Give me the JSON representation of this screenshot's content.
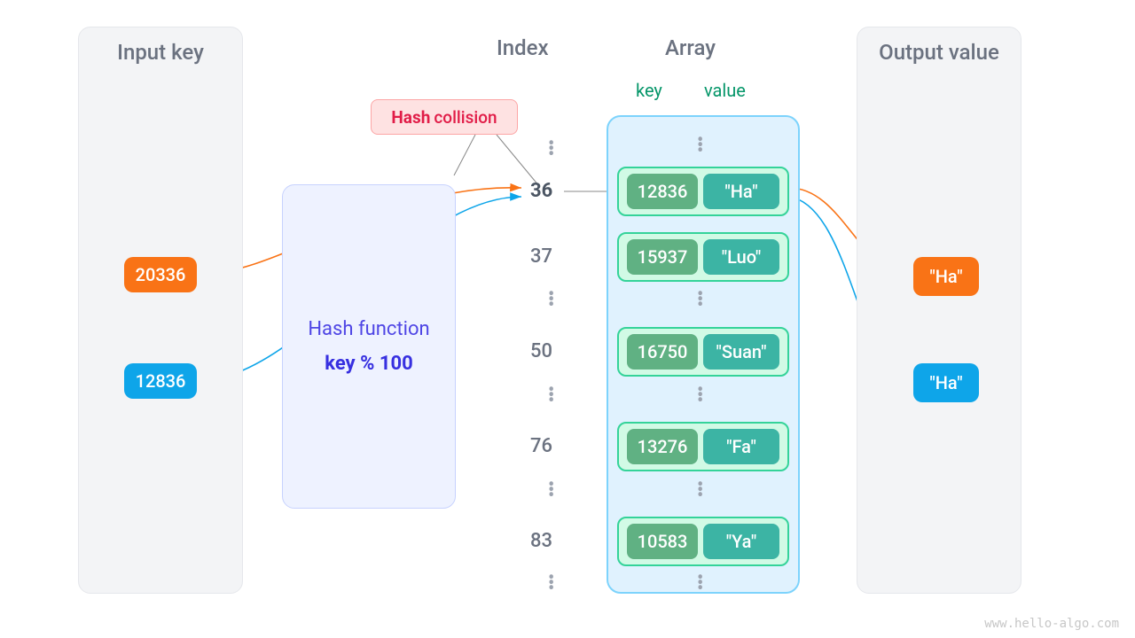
{
  "panels": {
    "input_title": "Input key",
    "output_title": "Output value"
  },
  "columns": {
    "index_title": "Index",
    "array_title": "Array",
    "kv_key_label": "key",
    "kv_val_label": "value"
  },
  "hashfn": {
    "title": "Hash function",
    "expr": "key % 100"
  },
  "collision": {
    "bold": "Hash",
    "rest": "collision"
  },
  "inputs": {
    "k1": "20336",
    "k2": "12836"
  },
  "outputs": {
    "v1": "\"Ha\"",
    "v2": "\"Ha\""
  },
  "indexes": {
    "i36": "36",
    "i37": "37",
    "i50": "50",
    "i76": "76",
    "i83": "83"
  },
  "buckets": {
    "b36": {
      "key": "12836",
      "val": "\"Ha\""
    },
    "b37": {
      "key": "15937",
      "val": "\"Luo\""
    },
    "b50": {
      "key": "16750",
      "val": "\"Suan\""
    },
    "b76": {
      "key": "13276",
      "val": "\"Fa\""
    },
    "b83": {
      "key": "10583",
      "val": "\"Ya\""
    }
  },
  "watermark": "www.hello-algo.com"
}
